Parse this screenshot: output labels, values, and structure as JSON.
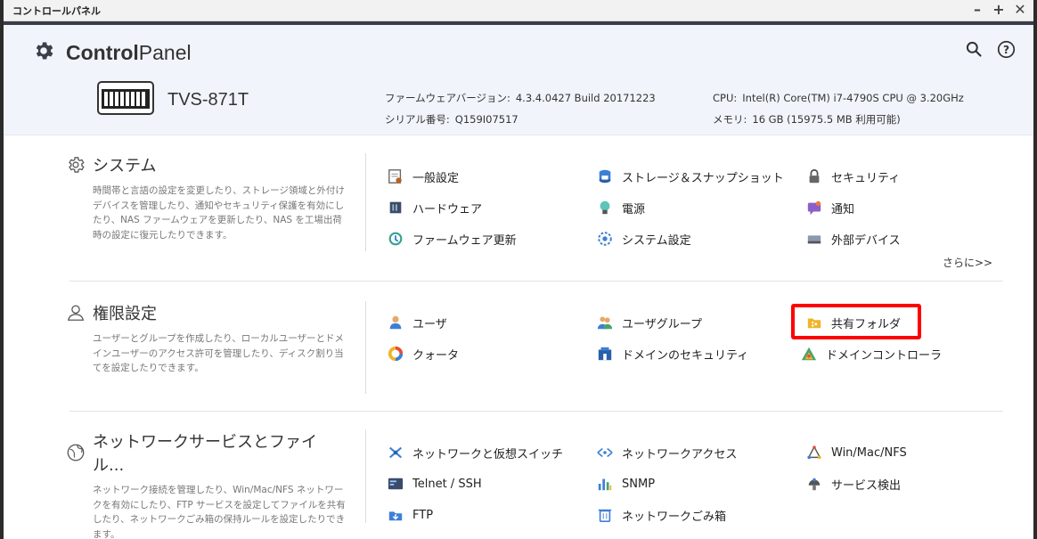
{
  "window": {
    "title": "コントロールパネル"
  },
  "header": {
    "brand_bold": "Control",
    "brand_light": "Panel",
    "model": "TVS-871T",
    "firmware_label": "ファームウェアバージョン:",
    "firmware_value": "4.3.4.0427 Build 20171223",
    "serial_label": "シリアル番号:",
    "serial_value": "Q159I07517",
    "cpu_label": "CPU:",
    "cpu_value": "Intel(R) Core(TM) i7-4790S CPU @ 3.20GHz",
    "memory_label": "メモリ:",
    "memory_value": "16 GB (15975.5 MB 利用可能)"
  },
  "sections": [
    {
      "title": "システム",
      "desc": "時間帯と言語の設定を変更したり、ストレージ領域と外付けデバイスを管理したり、通知やセキュリティ保護を有効にしたり、NAS ファームウェアを更新したり、NAS を工場出荷時の設定に復元したりできます。",
      "items": [
        "一般設定",
        "ストレージ＆スナップショット",
        "セキュリティ",
        "ハードウェア",
        "電源",
        "通知",
        "ファームウェア更新",
        "システム設定",
        "外部デバイス"
      ],
      "more": "さらに>>"
    },
    {
      "title": "権限設定",
      "desc": "ユーザーとグループを作成したり、ローカルユーザーとドメインユーザーのアクセス許可を管理したり、ディスク割り当てを設定したりできます。",
      "items": [
        "ユーザ",
        "ユーザグループ",
        "共有フォルダ",
        "クォータ",
        "ドメインのセキュリティ",
        "ドメインコントローラ"
      ]
    },
    {
      "title": "ネットワークサービスとファイル...",
      "desc": "ネットワーク接続を管理したり、Win/Mac/NFS ネットワークを有効にしたり、FTP サービスを設定してファイルを共有したり、ネットワークごみ箱の保持ルールを設定したりできます。",
      "items": [
        "ネットワークと仮想スイッチ",
        "ネットワークアクセス",
        "Win/Mac/NFS",
        "Telnet / SSH",
        "SNMP",
        "サービス検出",
        "FTP",
        "ネットワークごみ箱"
      ]
    }
  ],
  "colors": {
    "highlight": "#ff0000",
    "header_bg": "#f1f5fb"
  }
}
